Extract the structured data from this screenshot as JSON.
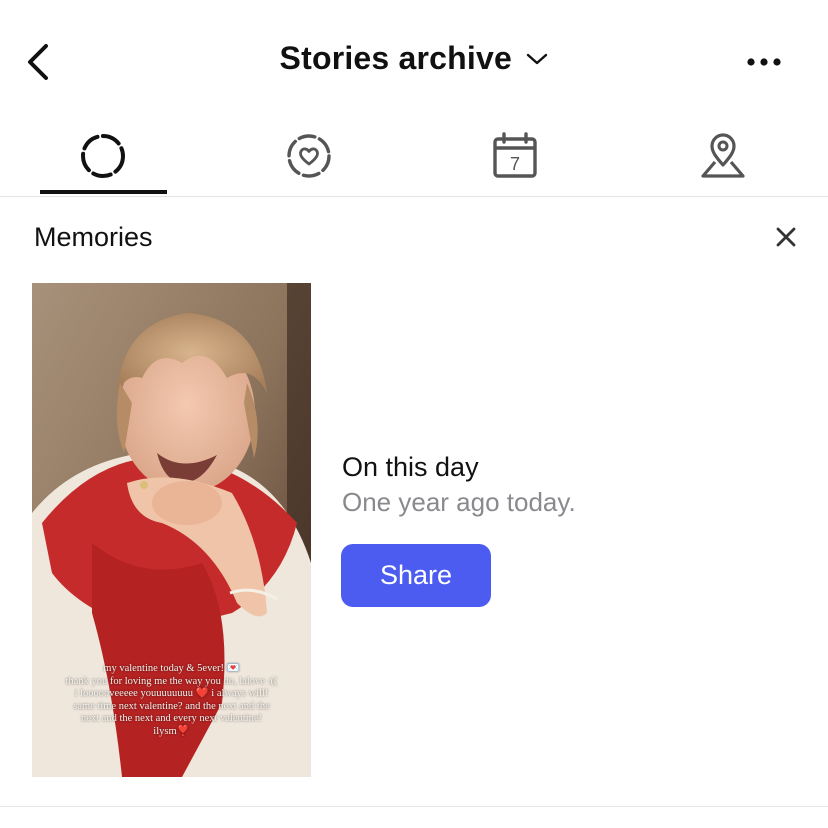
{
  "header": {
    "title": "Stories archive",
    "back_icon": "chevron-left-icon",
    "dropdown_icon": "chevron-down-icon",
    "more_icon": "more-horizontal-icon"
  },
  "tabs": [
    {
      "icon": "stories-ring-icon",
      "active": true
    },
    {
      "icon": "heart-ring-icon",
      "active": false
    },
    {
      "icon": "calendar-icon",
      "active": false,
      "badge": "7"
    },
    {
      "icon": "location-pin-icon",
      "active": false
    }
  ],
  "memories": {
    "title": "Memories",
    "close_icon": "close-icon",
    "story_caption": [
      "my valentine today & 5ever! 💌",
      "thank you for loving me the way you do, lalove :((",
      "i loooooveeeee youuuuuuuu ❤️ i always will!",
      "same time next valentine? and the next and the",
      "next and the next and every next valentine!",
      "ilysm❣️"
    ],
    "heading": "On this day",
    "subheading": "One year ago today.",
    "share_label": "Share"
  },
  "colors": {
    "accent": "#4d5cf0",
    "text_primary": "#111111",
    "text_secondary": "#8a8a8e"
  }
}
